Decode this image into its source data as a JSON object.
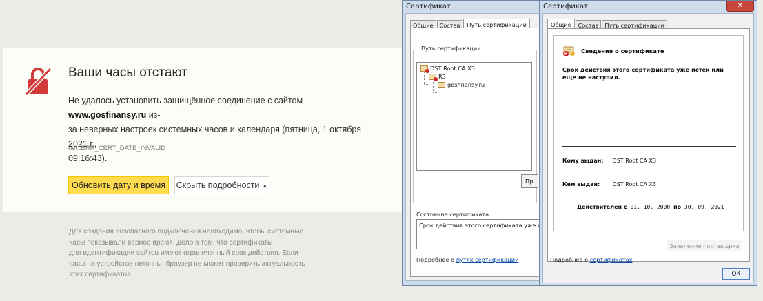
{
  "browser": {
    "title": "Ваши часы отстают",
    "desc_prefix": "Не удалось установить защищённое соединение с сайтом ",
    "desc_domain": "www.gosfinansy.ru",
    "desc_line1_end": " из-",
    "desc_line2": "за неверных настроек системных часов и календаря (пятница, 1 октября 2021 г.,",
    "desc_line3": "09:16:43).",
    "error_code": "net::ERR_CERT_DATE_INVALID",
    "update_button": "Обновить дату и время",
    "hide_details_button": "Скрыть подробности",
    "hide_arrow": "▲",
    "details_lines": [
      "Для создания безопасного подключения необходимо, чтобы системные",
      "часы показывали верное время. Дело в том, что сертификаты",
      "для идентификации сайтов имеют ограниченный срок действия. Если",
      "часы на устройстве неточны, браузер не может проверить актуальность",
      "этих сертификатов."
    ]
  },
  "cert_window_path": {
    "title": "Сертификат",
    "tabs": [
      "Общие",
      "Состав",
      "Путь сертификации"
    ],
    "active_tab": 2,
    "path_group_label": "Путь сертификации",
    "tree": [
      "DST Root CA X3",
      "R3",
      "gosfinansy.ru"
    ],
    "view_button": "Пр",
    "state_label": "Состояние сертификата:",
    "state_text": "Срок действия этого сертификата уже истек или",
    "more_prefix": "Подробнее о ",
    "more_link": "путях сертификации"
  },
  "cert_window_general": {
    "title": "Сертификат",
    "close_glyph": "✕",
    "tabs": [
      "Общие",
      "Состав",
      "Путь сертификации"
    ],
    "active_tab": 0,
    "info_title": "Сведения о сертификате",
    "expired_text_1": "Срок действия этого сертификата уже истек или",
    "expired_text_2": "еще не наступил.",
    "issued_to_label": "Кому выдан:",
    "issued_to_value": "DST Root CA X3",
    "issued_by_label": "Кем выдан:",
    "issued_by_value": "DST Root CA X3",
    "valid_from_label": "Действителен с",
    "valid_from": "01. 10. 2000",
    "valid_to_label": "по",
    "valid_to": "30. 09. 2021",
    "issuer_statement_button": "Заявление поставщика",
    "more_prefix": "Подробнее о ",
    "more_link": "сертификатах",
    "ok_button": "ОК"
  },
  "colors": {
    "accent_yellow": "#ffdb4d",
    "lock_red": "#d33b3b",
    "link_blue": "#0a4aa8"
  }
}
